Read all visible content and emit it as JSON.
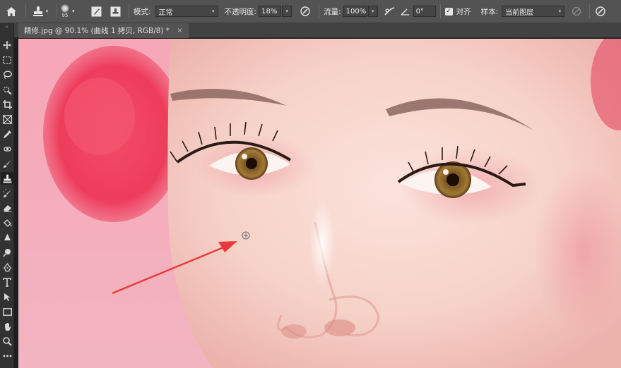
{
  "options_bar": {
    "brush_size": "95",
    "mode_label": "模式:",
    "mode_value": "正常",
    "opacity_label": "不透明度:",
    "opacity_value": "18%",
    "flow_label": "流量:",
    "flow_value": "100%",
    "angle_value": "0°",
    "align_label": "对齐",
    "align_checked": true,
    "sample_label": "样本:",
    "sample_value": "当前图层"
  },
  "document_tab": {
    "title": "精修.jpg @ 90.1% (曲线 1 拷贝, RGB/8) *",
    "close": "×"
  },
  "toolbar": {
    "active_tool": "clone-stamp",
    "tools": [
      "move",
      "marquee",
      "lasso",
      "quick-select",
      "crop",
      "frame",
      "eyedropper",
      "healing",
      "brush",
      "clone-stamp",
      "history-brush",
      "eraser",
      "paint-bucket",
      "blur",
      "dodge",
      "pen",
      "type",
      "path-select",
      "rectangle",
      "hand",
      "zoom",
      "more"
    ]
  },
  "canvas": {
    "cursor_icon": "clone-stamp-crosshair-icon",
    "annotation": "red-arrow"
  },
  "colors": {
    "accent_arrow": "#e83a3a",
    "panel_bg": "#535353",
    "toolbar_bg": "#323232"
  }
}
